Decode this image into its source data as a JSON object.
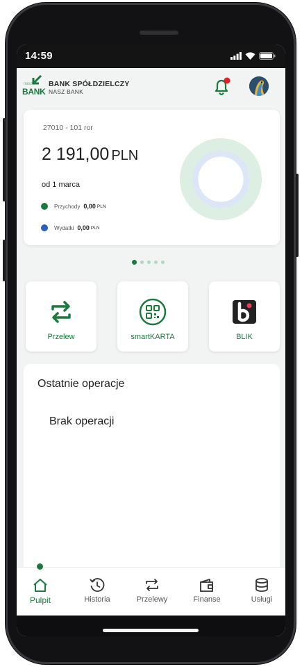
{
  "status_bar": {
    "time": "14:59"
  },
  "header": {
    "logo_small": "nasz",
    "logo_big": "BANK",
    "bank_name": "BANK SPÓŁDZIELCZY",
    "bank_subtitle": "NASZ BANK"
  },
  "account": {
    "name": "27010 - 101 ror",
    "balance": "2 191,00",
    "currency": "PLN",
    "period": "od 1 marca",
    "income_label": "Przychody",
    "income_value": "0,00",
    "income_currency": "PLN",
    "expense_label": "Wydatki",
    "expense_value": "0,00",
    "expense_currency": "PLN",
    "colors": {
      "income": "#1a7a3c",
      "expense": "#2e5fbf"
    }
  },
  "pager": {
    "count": 5,
    "active_index": 0
  },
  "tiles": [
    {
      "label": "Przelew",
      "icon": "transfer-icon"
    },
    {
      "label": "smartKARTA",
      "icon": "qr-code-icon"
    },
    {
      "label": "BLIK",
      "icon": "blik-icon"
    }
  ],
  "recent": {
    "title": "Ostatnie operacje",
    "empty_text": "Brak operacji"
  },
  "nav": {
    "items": [
      {
        "label": "Pulpit",
        "icon": "home-icon",
        "active": true
      },
      {
        "label": "Historia",
        "icon": "history-icon",
        "active": false
      },
      {
        "label": "Przelewy",
        "icon": "transfers-icon",
        "active": false
      },
      {
        "label": "Finanse",
        "icon": "wallet-icon",
        "active": false
      },
      {
        "label": "Usługi",
        "icon": "database-icon",
        "active": false
      }
    ]
  },
  "colors": {
    "brand": "#1a7a3c",
    "notification_dot": "#e21f26"
  }
}
